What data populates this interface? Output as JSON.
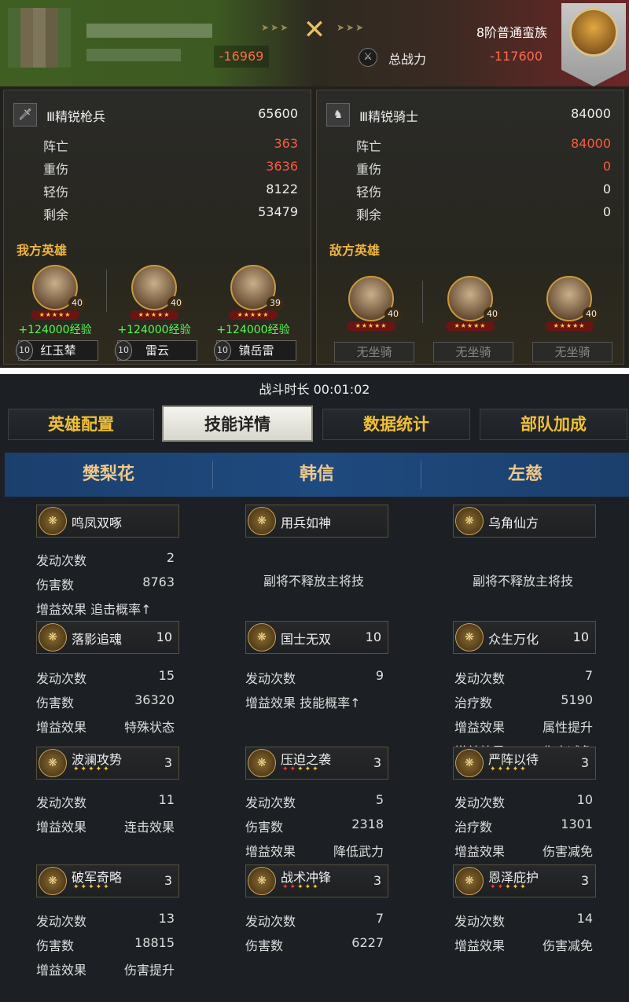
{
  "header": {
    "my_score": "-16969",
    "power_label": "总战力",
    "enemy_score": "-117600",
    "enemy_type": "8阶普通蛮族",
    "arrows": "➤➤➤"
  },
  "left": {
    "unit_icon": "🗡",
    "unit_name": "Ⅲ精锐枪兵",
    "unit_total": "65600",
    "stats": [
      {
        "label": "阵亡",
        "value": "363",
        "red": true
      },
      {
        "label": "重伤",
        "value": "3636",
        "red": true
      },
      {
        "label": "轻伤",
        "value": "8122",
        "red": false
      },
      {
        "label": "剩余",
        "value": "53479",
        "red": false
      }
    ],
    "section_title": "我方英雄",
    "heroes": [
      {
        "level": "40",
        "stars": "★★★★★",
        "exp": "+124000经验",
        "name": "红玉辇",
        "name_level": "10"
      },
      {
        "level": "40",
        "stars": "★★★★★",
        "exp": "+124000经验",
        "name": "雷云",
        "name_level": "10"
      },
      {
        "level": "39",
        "stars": "★★★★★",
        "exp": "+124000经验",
        "name": "镇岳雷",
        "name_level": "10"
      }
    ]
  },
  "right": {
    "unit_icon": "♞",
    "unit_name": "Ⅲ精锐骑士",
    "unit_total": "84000",
    "stats": [
      {
        "label": "阵亡",
        "value": "84000",
        "red": true
      },
      {
        "label": "重伤",
        "value": "0",
        "red": true
      },
      {
        "label": "轻伤",
        "value": "0",
        "red": false
      },
      {
        "label": "剩余",
        "value": "0",
        "red": false
      }
    ],
    "section_title": "敌方英雄",
    "heroes": [
      {
        "level": "40",
        "stars": "★★★★★",
        "mount": "无坐骑"
      },
      {
        "level": "40",
        "stars": "★★★★★",
        "mount": "无坐骑"
      },
      {
        "level": "40",
        "stars": "★★★★★",
        "mount": "无坐骑"
      }
    ]
  },
  "duration": "战斗时长 00:01:02",
  "tabs": [
    {
      "label": "英雄配置"
    },
    {
      "label": "技能详情"
    },
    {
      "label": "数据统计"
    },
    {
      "label": "部队加成"
    }
  ],
  "hero_names": [
    "樊梨花",
    "韩信",
    "左慈"
  ],
  "columns": [
    {
      "skills": [
        {
          "name": "鸣凤双啄",
          "level": "",
          "stars": "",
          "stats": [
            {
              "label": "发动次数",
              "value": "2"
            },
            {
              "label": "伤害数",
              "value": "8763"
            },
            {
              "label": "增益效果 追击概率↑",
              "value": ""
            }
          ]
        },
        {
          "name": "落影追魂",
          "level": "10",
          "stars": "",
          "stats": [
            {
              "label": "发动次数",
              "value": "15"
            },
            {
              "label": "伤害数",
              "value": "36320"
            },
            {
              "label": "增益效果",
              "value": "特殊状态"
            }
          ]
        },
        {
          "name": "波澜攻势",
          "level": "3",
          "stars": "✦✦✦✦✦",
          "stats": [
            {
              "label": "发动次数",
              "value": "11"
            },
            {
              "label": "增益效果",
              "value": "连击效果"
            }
          ]
        },
        {
          "name": "破军奇略",
          "level": "3",
          "stars": "✦✦✦✦✦",
          "stats": [
            {
              "label": "发动次数",
              "value": "13"
            },
            {
              "label": "伤害数",
              "value": "18815"
            },
            {
              "label": "增益效果",
              "value": "伤害提升"
            }
          ]
        }
      ]
    },
    {
      "skills": [
        {
          "name": "用兵如神",
          "level": "",
          "stars": "",
          "note": "副将不释放主将技",
          "stats": []
        },
        {
          "name": "国士无双",
          "level": "10",
          "stars": "",
          "stats": [
            {
              "label": "发动次数",
              "value": "9"
            },
            {
              "label": "增益效果 技能概率↑",
              "value": ""
            }
          ]
        },
        {
          "name": "压迫之袭",
          "level": "3",
          "stars": "✦✦✦✦✦",
          "stats": [
            {
              "label": "发动次数",
              "value": "5"
            },
            {
              "label": "伤害数",
              "value": "2318"
            },
            {
              "label": "增益效果",
              "value": "降低武力"
            }
          ]
        },
        {
          "name": "战术冲锋",
          "level": "3",
          "stars": "✦✦✦✦✦",
          "stats": [
            {
              "label": "发动次数",
              "value": "7"
            },
            {
              "label": "伤害数",
              "value": "6227"
            }
          ]
        }
      ]
    },
    {
      "skills": [
        {
          "name": "乌角仙方",
          "level": "",
          "stars": "",
          "note": "副将不释放主将技",
          "stats": []
        },
        {
          "name": "众生万化",
          "level": "10",
          "stars": "",
          "stats": [
            {
              "label": "发动次数",
              "value": "7"
            },
            {
              "label": "治疗数",
              "value": "5190"
            },
            {
              "label": "增益效果",
              "value": "属性提升"
            },
            {
              "label": "增益效果",
              "value": "伤害减免"
            }
          ]
        },
        {
          "name": "严阵以待",
          "level": "3",
          "stars": "✦✦✦✦✦",
          "stats": [
            {
              "label": "发动次数",
              "value": "10"
            },
            {
              "label": "治疗数",
              "value": "1301"
            },
            {
              "label": "增益效果",
              "value": "伤害减免"
            }
          ]
        },
        {
          "name": "恩泽庇护",
          "level": "3",
          "stars": "✦✦✦✦✦",
          "stats": [
            {
              "label": "发动次数",
              "value": "14"
            },
            {
              "label": "增益效果",
              "value": "伤害减免"
            }
          ]
        }
      ]
    }
  ]
}
